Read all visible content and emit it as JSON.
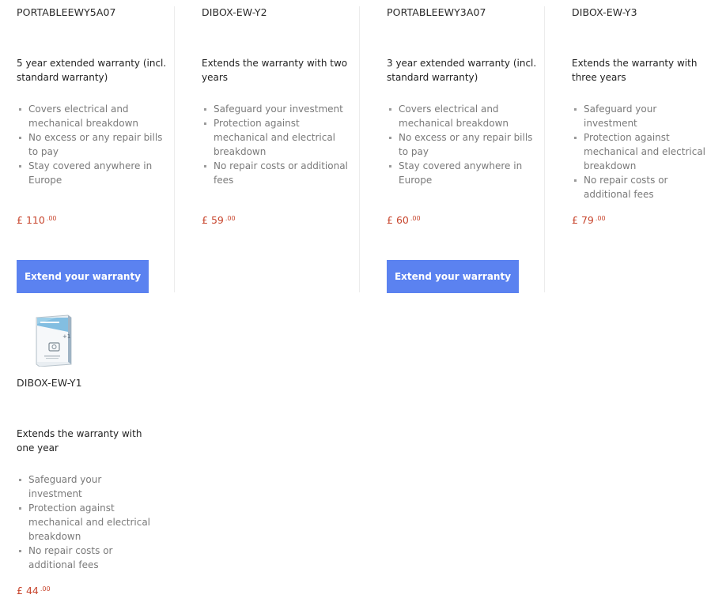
{
  "products": [
    {
      "sku": "PORTABLEEWY5A07",
      "description": "5 year extended warranty (incl. standard warranty)",
      "bullets": [
        "Covers electrical and mechanical breakdown",
        "No excess or any repair bills to pay",
        "Stay covered anywhere in Europe"
      ],
      "price_symbol": "£",
      "price_whole": "110",
      "price_cents": ".00",
      "button_label": "Extend your warranty"
    },
    {
      "sku": "DIBOX-EW-Y2",
      "description": "Extends the warranty with two years",
      "bullets": [
        "Safeguard your investment",
        "Protection against mechanical and electrical breakdown",
        "No repair costs or additional fees"
      ],
      "price_symbol": "£",
      "price_whole": "59",
      "price_cents": ".00"
    },
    {
      "sku": "PORTABLEEWY3A07",
      "description": "3 year extended warranty (incl. standard warranty)",
      "bullets": [
        "Covers electrical and mechanical breakdown",
        "No excess or any repair bills to pay",
        "Stay covered anywhere in Europe"
      ],
      "price_symbol": "£",
      "price_whole": "60",
      "price_cents": ".00",
      "button_label": "Extend your warranty"
    },
    {
      "sku": "DIBOX-EW-Y3",
      "description": "Extends the warranty with three years",
      "bullets": [
        "Safeguard your investment",
        "Protection against mechanical and electrical breakdown",
        "No repair costs or additional fees"
      ],
      "price_symbol": "£",
      "price_whole": "79",
      "price_cents": ".00"
    },
    {
      "sku": "DIBOX-EW-Y1",
      "description": "Extends the warranty with one year",
      "bullets": [
        "Safeguard your investment",
        "Protection against mechanical and electrical breakdown",
        "No repair costs or additional fees"
      ],
      "price_symbol": "£",
      "price_whole": "44",
      "price_cents": ".00",
      "image_icon": "warranty-box-icon"
    }
  ],
  "colors": {
    "price": "#c8462e",
    "button": "#5b82f0",
    "bullet_text": "#7a7a7a"
  }
}
